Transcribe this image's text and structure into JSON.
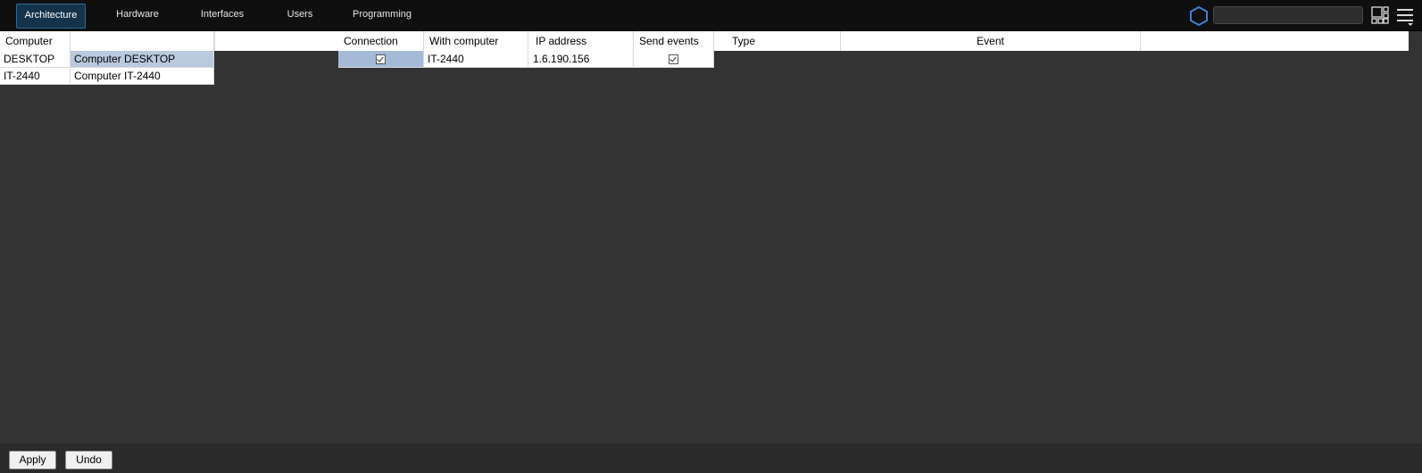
{
  "tabs": [
    {
      "label": "Architecture",
      "active": true
    },
    {
      "label": "Hardware"
    },
    {
      "label": "Interfaces"
    },
    {
      "label": "Users"
    },
    {
      "label": "Programming"
    }
  ],
  "search": {
    "value": ""
  },
  "icons": {
    "hex": "hexagon-icon",
    "layout": "layout-grid-icon",
    "menu": "hamburger-menu-icon"
  },
  "computers": {
    "header": "Computer",
    "rows": [
      {
        "name": "DESKTOP",
        "description": "Computer DESKTOP",
        "selected": true
      },
      {
        "name": "IT-2440",
        "description": "Computer IT-2440"
      }
    ]
  },
  "connections": {
    "headers": {
      "connection": "Connection",
      "with_computer": "With computer",
      "ip_address": "IP address",
      "send_events": "Send events"
    },
    "rows": [
      {
        "connection": true,
        "with_computer": "IT-2440",
        "ip_address": "1.6.190.156",
        "send_events": true
      }
    ]
  },
  "events": {
    "headers": {
      "type": "Type",
      "event": "Event"
    }
  },
  "buttons": {
    "apply": "Apply",
    "undo": "Undo"
  },
  "colors": {
    "background": "#333333",
    "topbar": "#0f0f10",
    "active_tab": "#14324a",
    "selection": "#b9c9de",
    "hex_icon": "#3f7fd6"
  }
}
